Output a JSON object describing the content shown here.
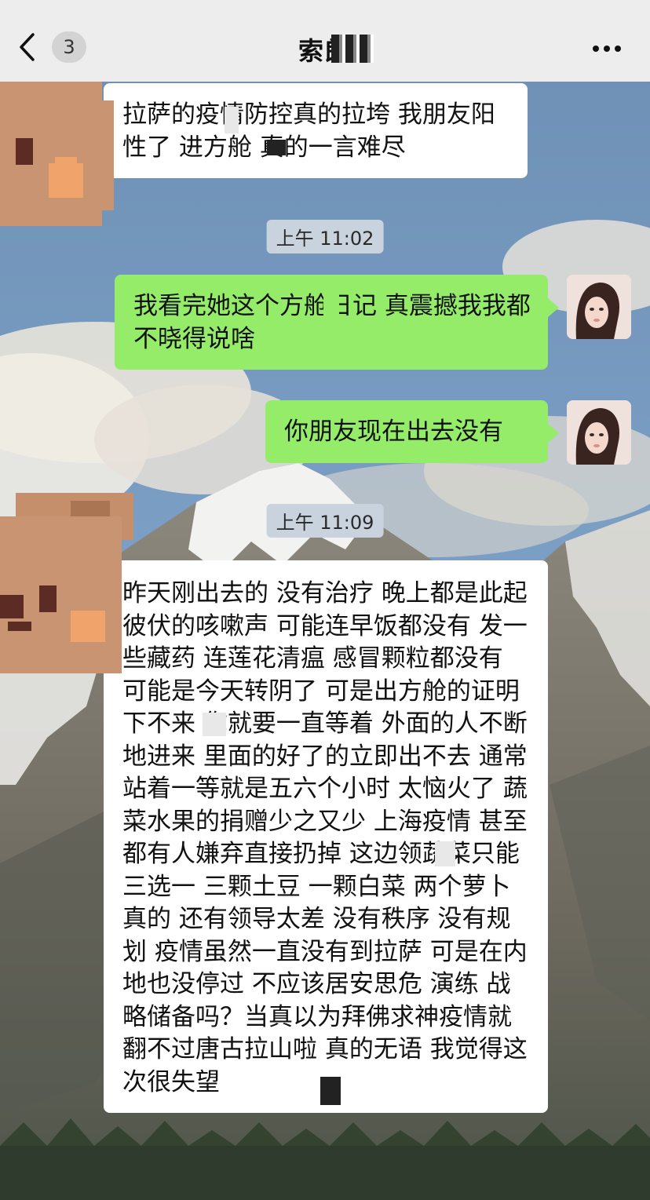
{
  "header": {
    "unread_count": "3",
    "title": "索朗",
    "back_icon": "chevron-left-icon",
    "more_icon": "ellipsis-icon"
  },
  "messages": [
    {
      "type": "incoming",
      "text": "拉萨的疫情防控真的拉垮 我朋友阳性了 进方舱 真的一言难尽"
    },
    {
      "type": "timestamp",
      "text": "上午 11:02"
    },
    {
      "type": "outgoing",
      "text": "我看完她这个方舱日记 真震撼我我都不晓得说啥"
    },
    {
      "type": "outgoing",
      "text": "你朋友现在出去没有"
    },
    {
      "type": "timestamp",
      "text": "上午 11:09"
    },
    {
      "type": "incoming",
      "text": "昨天刚出去的 没有治疗 晚上都是此起彼伏的咳嗽声 可能连早饭都没有 发一些藏药 连莲花清瘟 感冒颗粒都没有 可能是今天转阴了 可是出方舱的证明下不来 你就要一直等着 外面的人不断地进来 里面的好了的立即出不去 通常站着一等就是五六个小时 太恼火了 蔬菜水果的捐赠少之又少 上海疫情 甚至都有人嫌弃直接扔掉 这边领蔬菜只能三选一 三颗土豆 一颗白菜 两个萝卜 真的 还有领导太差 没有秩序 没有规划 疫情虽然一直没有到拉萨 可是在内地也没停过 不应该居安思危 演练 战略储备吗？当真以为拜佛求神疫情就翻不过唐古拉山啦 真的无语 我觉得这次很失望"
    }
  ],
  "colors": {
    "header_bg": "#ededed",
    "incoming_bubble": "#ffffff",
    "outgoing_bubble": "#95ec69",
    "timestamp_bg": "#c9d3de"
  }
}
